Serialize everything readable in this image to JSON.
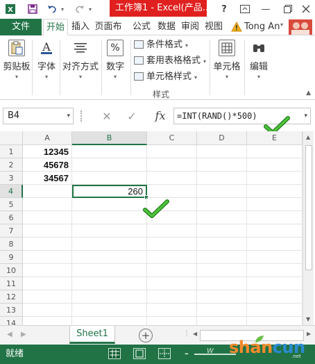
{
  "title_bar": {
    "title": "工作簿1 - Excel(产品...",
    "help": "?",
    "restore": "□",
    "minimize": "—"
  },
  "tabs": {
    "file": "文件",
    "home": "开始",
    "insert": "插入",
    "page_layout": "页面布",
    "formulas": "公式",
    "data": "数据",
    "review": "审阅",
    "view": "视图",
    "user": "Tong An"
  },
  "ribbon": {
    "clipboard": "剪贴板",
    "font": "字体",
    "alignment": "对齐方式",
    "number": "数字",
    "conditional_format": "条件格式",
    "format_as_table": "套用表格格式",
    "cell_styles": "单元格样式",
    "styles_group": "样式",
    "cells": "单元格",
    "editing": "编辑"
  },
  "formula_bar": {
    "name_box": "B4",
    "cancel": "✕",
    "enter": "✓",
    "fx": "fx",
    "formula": "=INT(RAND()*500)"
  },
  "grid": {
    "columns": [
      "A",
      "B",
      "C",
      "D",
      "E"
    ],
    "rows": [
      "1",
      "2",
      "3",
      "4",
      "5",
      "6",
      "7",
      "8",
      "9",
      "10",
      "11",
      "12",
      "13",
      "14"
    ],
    "active_column": "B",
    "active_row": "4",
    "cells": {
      "A1": "12345",
      "A2": "45678",
      "A3": "34567",
      "B4": "260"
    }
  },
  "sheets": {
    "active": "Sheet1",
    "add": "⊕"
  },
  "status_bar": {
    "status": "就绪",
    "zoom_minus": "-"
  },
  "watermark": {
    "brand_s": "sha",
    "brand_n": "n",
    "brand_rest": "cun",
    "small": "W",
    "domain": ".net"
  },
  "colors": {
    "excel_green": "#217346",
    "title_red": "#e0201f",
    "check_green": "#3aa12e"
  }
}
